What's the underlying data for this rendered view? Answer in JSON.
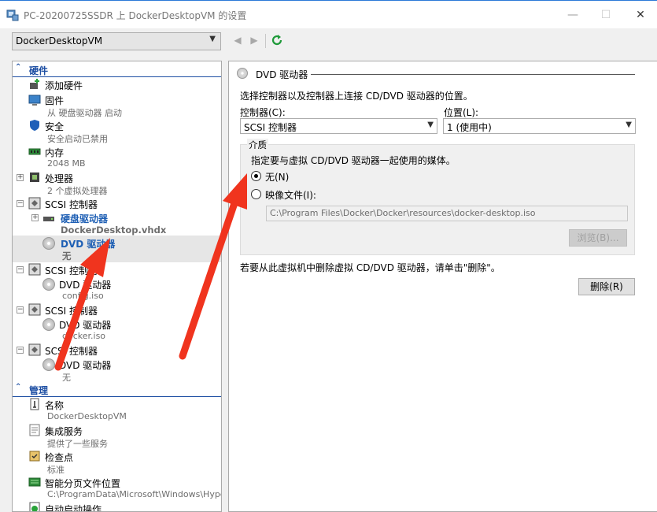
{
  "window": {
    "title": "PC-20200725SSDR 上 DockerDesktopVM 的设置",
    "min_label": "—",
    "max_label": "☐",
    "close_label": "✕"
  },
  "toolbar": {
    "vm_selected": "DockerDesktopVM",
    "back_label": "◀",
    "forward_label": "▶"
  },
  "tree": {
    "hardware_section": "硬件",
    "management_section": "管理",
    "items": {
      "add_hardware": "添加硬件",
      "firmware": "固件",
      "firmware_sub": "从 硬盘驱动器 启动",
      "security": "安全",
      "security_sub": "安全启动已禁用",
      "memory": "内存",
      "memory_sub": "2048 MB",
      "processor": "处理器",
      "processor_sub": "2 个虚拟处理器",
      "scsi1": "SCSI 控制器",
      "hdd": "硬盘驱动器",
      "hdd_sub": "DockerDesktop.vhdx",
      "dvd1": "DVD 驱动器",
      "dvd1_sub": "无",
      "scsi2": "SCSI 控制器",
      "dvd2": "DVD 驱动器",
      "dvd2_sub": "config.iso",
      "scsi3": "SCSI 控制器",
      "dvd3": "DVD 驱动器",
      "dvd3_sub": "docker.iso",
      "scsi4": "SCSI 控制器",
      "dvd4": "DVD 驱动器",
      "dvd4_sub": "无",
      "name": "名称",
      "name_sub": "DockerDesktopVM",
      "integration": "集成服务",
      "integration_sub": "提供了一些服务",
      "checkpoint": "检查点",
      "checkpoint_sub": "标准",
      "smartpaging": "智能分页文件位置",
      "smartpaging_sub": "C:\\ProgramData\\Microsoft\\Windows\\Hyper-V",
      "autostart": "自动启动操作"
    }
  },
  "details": {
    "title": "DVD 驱动器",
    "description": "选择控制器以及控制器上连接 CD/DVD 驱动器的位置。",
    "controller_label": "控制器(C):",
    "controller_value": "SCSI 控制器",
    "location_label": "位置(L):",
    "location_value": "1 (使用中)",
    "media_group": "介质",
    "media_desc": "指定要与虚拟 CD/DVD 驱动器一起使用的媒体。",
    "none_option": "无(N)",
    "image_option": "映像文件(I):",
    "image_path": "C:\\Program Files\\Docker\\Docker\\resources\\docker-desktop.iso",
    "browse_button": "浏览(B)...",
    "remove_hint": "若要从此虚拟机中删除虚拟 CD/DVD 驱动器，请单击\"删除\"。",
    "remove_button": "删除(R)"
  },
  "colors": {
    "accent": "#1e4fa3",
    "selection": "#e6e6e6",
    "arrow": "#f0341e"
  }
}
